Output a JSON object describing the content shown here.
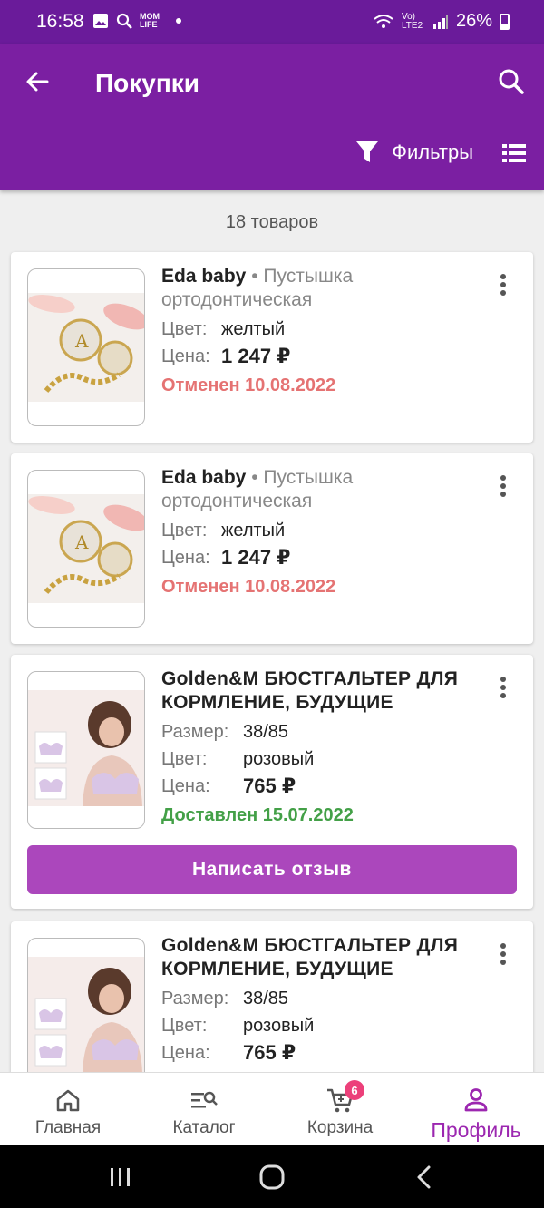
{
  "status_bar": {
    "time": "16:58",
    "icons": [
      "image-icon",
      "search-icon",
      "mom-life-icon",
      "dot-icon"
    ],
    "mom_life": "MOM LIFE",
    "network": "Vo) LTE2",
    "battery": "26%"
  },
  "appbar": {
    "title": "Покупки",
    "filters_label": "Фильтры"
  },
  "list": {
    "count_label": "18 товаров"
  },
  "cards": [
    {
      "brand": "Eda baby",
      "separator": " • ",
      "name": "Пустышка ортодонтическая",
      "color_label": "Цвет:",
      "color_value": "желтый",
      "price_label": "Цена:",
      "price_value": "1 247 ₽",
      "status": "Отменен 10.08.2022"
    },
    {
      "brand": "Eda baby",
      "separator": " • ",
      "name": "Пустышка ортодонтическая",
      "color_label": "Цвет:",
      "color_value": "желтый",
      "price_label": "Цена:",
      "price_value": "1 247 ₽",
      "status": "Отменен 10.08.2022"
    },
    {
      "title": "Golden&M БЮСТГАЛЬТЕР ДЛЯ КОРМЛЕНИЕ, БУДУЩИЕ",
      "size_label": "Размер:",
      "size_value": "38/85",
      "color_label": "Цвет:",
      "color_value": "розовый",
      "price_label": "Цена:",
      "price_value": "765 ₽",
      "status": "Доставлен 15.07.2022",
      "review_button": "Написать отзыв"
    },
    {
      "title": "Golden&M БЮСТГАЛЬТЕР ДЛЯ КОРМЛЕНИЕ, БУДУЩИЕ",
      "size_label": "Размер:",
      "size_value": "38/85",
      "color_label": "Цвет:",
      "color_value": "розовый",
      "price_label": "Цена:",
      "price_value": "765 ₽"
    }
  ],
  "bottom_nav": {
    "home": "Главная",
    "catalog": "Каталог",
    "cart": "Корзина",
    "cart_badge": "6",
    "profile": "Профиль"
  },
  "colors": {
    "primary": "#7b1fa2",
    "status_bar": "#6a1b9a",
    "accent": "#ab47bc",
    "cancelled": "#e57373",
    "delivered": "#43a047",
    "badge": "#ec407a"
  }
}
